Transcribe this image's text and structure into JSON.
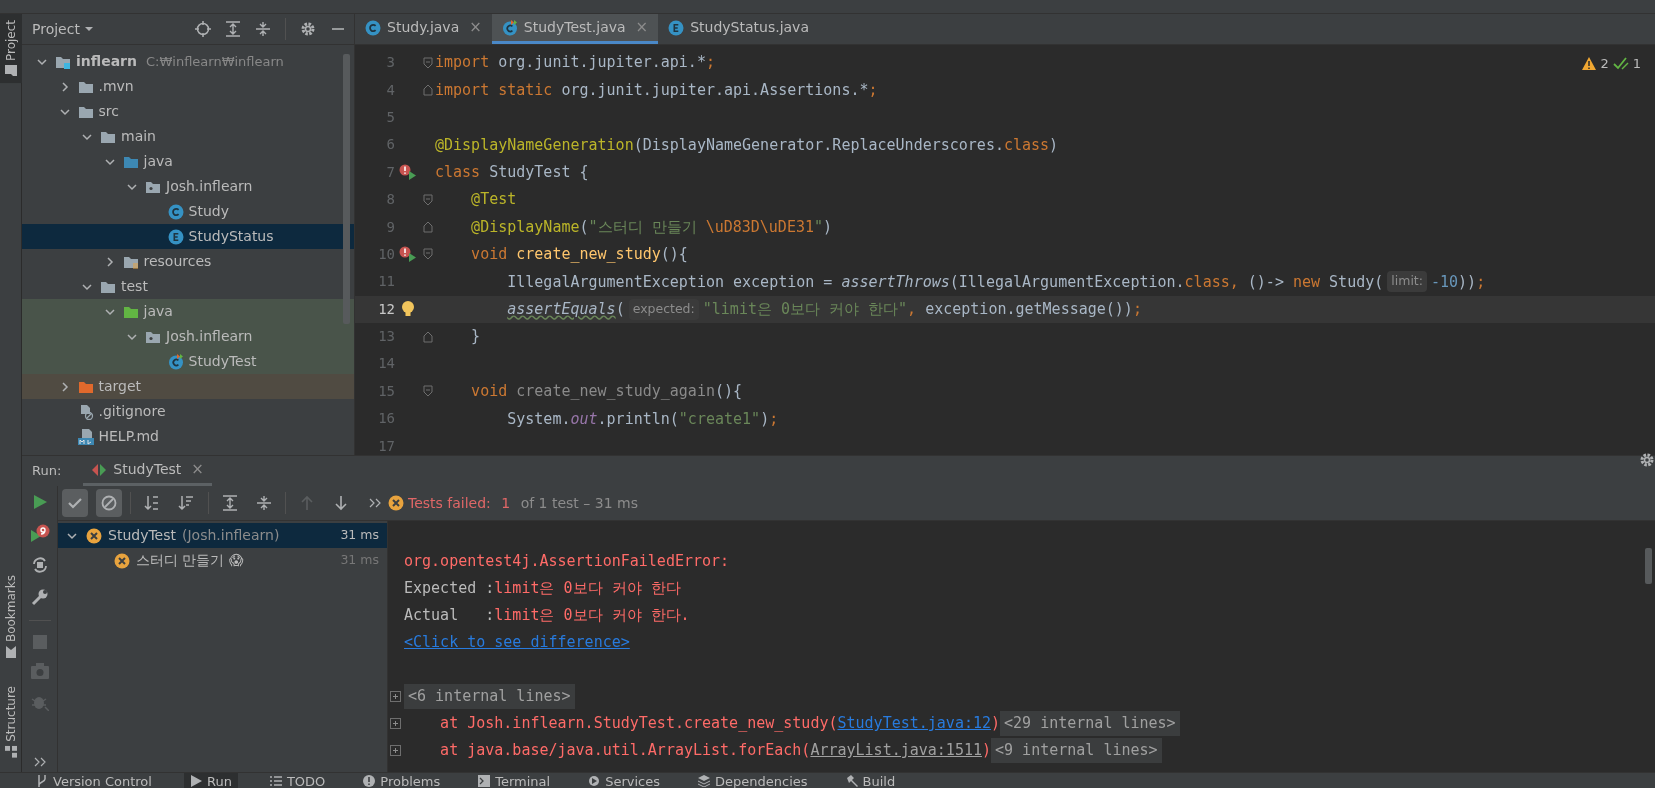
{
  "left_stripe": [
    {
      "label": "Project",
      "selected": true,
      "kind": "project"
    },
    {
      "label": "Bookmarks",
      "selected": false,
      "kind": "bookmarks"
    },
    {
      "label": "Structure",
      "selected": false,
      "kind": "structure"
    }
  ],
  "project": {
    "title": "Project",
    "tree": [
      {
        "name": "inflearn",
        "path": "C:₩inflearn₩inflearn",
        "kind": "module",
        "expanded": true,
        "selected": false,
        "children": [
          {
            "name": ".mvn",
            "kind": "folder",
            "expanded": false,
            "selected": false
          },
          {
            "name": "src",
            "kind": "folder",
            "expanded": true,
            "selected": false,
            "children": [
              {
                "name": "main",
                "kind": "folder",
                "expanded": true,
                "selected": false,
                "children": [
                  {
                    "name": "java",
                    "kind": "source-root",
                    "expanded": true,
                    "selected": false,
                    "children": [
                      {
                        "name": "Josh.inflearn",
                        "kind": "package",
                        "expanded": true,
                        "selected": false,
                        "children": [
                          {
                            "name": "Study",
                            "kind": "class",
                            "selected": false
                          },
                          {
                            "name": "StudyStatus",
                            "kind": "enum",
                            "selected": true
                          }
                        ]
                      }
                    ]
                  },
                  {
                    "name": "resources",
                    "kind": "resources-root",
                    "expanded": false,
                    "selected": false
                  }
                ]
              },
              {
                "name": "test",
                "kind": "folder",
                "expanded": true,
                "selected": false,
                "children": [
                  {
                    "name": "java",
                    "kind": "test-root",
                    "expanded": true,
                    "selected": false,
                    "children": [
                      {
                        "name": "Josh.inflearn",
                        "kind": "package",
                        "expanded": true,
                        "selected": false,
                        "children": [
                          {
                            "name": "StudyTest",
                            "kind": "test-class",
                            "selected": false
                          }
                        ]
                      }
                    ]
                  }
                ]
              }
            ]
          },
          {
            "name": "target",
            "kind": "excluded-folder",
            "expanded": false,
            "selected": false
          },
          {
            "name": ".gitignore",
            "kind": "ignore-file",
            "selected": false
          },
          {
            "name": "HELP.md",
            "kind": "markdown-file",
            "selected": false
          }
        ]
      }
    ]
  },
  "editor": {
    "tabs": [
      {
        "label": "Study.java",
        "kind": "class",
        "selected": false,
        "close": "×"
      },
      {
        "label": "StudyTest.java",
        "kind": "test-class",
        "selected": true,
        "close": "×"
      },
      {
        "label": "StudyStatus.java",
        "kind": "enum",
        "selected": false
      }
    ],
    "warnings": "2",
    "passed": "1",
    "lines": [
      {
        "number": "3",
        "current": false,
        "markers": [
          {
            "kind": "fold-start"
          }
        ],
        "tokens": [
          {
            "text": "import ",
            "kind": "keyword"
          },
          {
            "text": "org.junit.jupiter.api.*",
            "kind": "plain"
          },
          {
            "text": ";",
            "kind": "keyword"
          }
        ]
      },
      {
        "number": "4",
        "current": false,
        "markers": [
          {
            "kind": "fold-end"
          }
        ],
        "tokens": [
          {
            "text": "import static ",
            "kind": "keyword"
          },
          {
            "text": "org.junit.jupiter.api.Assertions.*",
            "kind": "plain"
          },
          {
            "text": ";",
            "kind": "keyword"
          }
        ]
      },
      {
        "number": "5",
        "current": false
      },
      {
        "number": "6",
        "current": false,
        "tokens": [
          {
            "text": "@DisplayNameGeneration",
            "kind": "annotation"
          },
          {
            "text": "(DisplayNameGenerator.ReplaceUnderscores.",
            "kind": "plain"
          },
          {
            "text": "class",
            "kind": "keyword"
          },
          {
            "text": ")",
            "kind": "plain"
          }
        ]
      },
      {
        "number": "7",
        "current": false,
        "markers": [
          {
            "kind": "run-failed"
          }
        ],
        "tokens": [
          {
            "text": "class ",
            "kind": "keyword"
          },
          {
            "text": "StudyTest {",
            "kind": "plain"
          }
        ]
      },
      {
        "number": "8",
        "current": false,
        "markers": [
          {
            "kind": "fold-start"
          }
        ],
        "tokens": [
          {
            "text": "    @Test",
            "kind": "annotation"
          }
        ]
      },
      {
        "number": "9",
        "current": false,
        "markers": [
          {
            "kind": "fold-end"
          }
        ],
        "tokens": [
          {
            "text": "    @DisplayName",
            "kind": "annotation"
          },
          {
            "text": "(",
            "kind": "plain"
          },
          {
            "text": "\"스터디 만들기 ",
            "kind": "string"
          },
          {
            "text": "\\uD83D\\uDE31",
            "kind": "escape"
          },
          {
            "text": "\"",
            "kind": "string"
          },
          {
            "text": ")",
            "kind": "plain"
          }
        ]
      },
      {
        "number": "10",
        "current": false,
        "markers": [
          {
            "kind": "run-failed"
          },
          {
            "kind": "fold-start"
          }
        ],
        "tokens": [
          {
            "text": "    void ",
            "kind": "keyword"
          },
          {
            "text": "create_new_study",
            "kind": "method"
          },
          {
            "text": "(){",
            "kind": "plain"
          }
        ]
      },
      {
        "number": "11",
        "current": false,
        "tokens": [
          {
            "text": "        IllegalArgumentException exception = ",
            "kind": "plain"
          },
          {
            "text": "assertThrows",
            "kind": "static"
          },
          {
            "text": "(IllegalArgumentException.",
            "kind": "plain"
          },
          {
            "text": "class,",
            "kind": "keyword"
          },
          {
            "text": " ()-> ",
            "kind": "plain"
          },
          {
            "text": "new ",
            "kind": "keyword"
          },
          {
            "text": "Study(",
            "kind": "plain"
          },
          {
            "text": "limit:",
            "kind": "hint"
          },
          {
            "text": "-10",
            "kind": "number"
          },
          {
            "text": "))",
            "kind": "plain"
          },
          {
            "text": ";",
            "kind": "keyword"
          }
        ]
      },
      {
        "number": "12",
        "current": true,
        "markers": [
          {
            "kind": "bulb"
          }
        ],
        "tokens": [
          {
            "text": "        assertEquals",
            "kind": "static-warning"
          },
          {
            "text": "(",
            "kind": "plain"
          },
          {
            "text": "expected:",
            "kind": "hint"
          },
          {
            "text": "\"limit은 0보다 커야 한다\"",
            "kind": "string"
          },
          {
            "text": ",",
            "kind": "keyword"
          },
          {
            "text": " exception.getMessage())",
            "kind": "plain"
          },
          {
            "text": ";",
            "kind": "keyword"
          }
        ]
      },
      {
        "number": "13",
        "current": false,
        "markers": [
          {
            "kind": "fold-end"
          }
        ],
        "tokens": [
          {
            "text": "    }",
            "kind": "plain"
          }
        ]
      },
      {
        "number": "14",
        "current": false
      },
      {
        "number": "15",
        "current": false,
        "markers": [
          {
            "kind": "fold-start"
          }
        ],
        "tokens": [
          {
            "text": "    void ",
            "kind": "keyword"
          },
          {
            "text": "create_new_study_again",
            "kind": "unused"
          },
          {
            "text": "(){",
            "kind": "plain"
          }
        ]
      },
      {
        "number": "16",
        "current": false,
        "tokens": [
          {
            "text": "        System.",
            "kind": "plain"
          },
          {
            "text": "out",
            "kind": "field"
          },
          {
            "text": ".println(",
            "kind": "plain"
          },
          {
            "text": "\"create1\"",
            "kind": "string"
          },
          {
            "text": ")",
            "kind": "plain"
          },
          {
            "text": ";",
            "kind": "keyword"
          }
        ]
      },
      {
        "number": "17",
        "current": false
      }
    ]
  },
  "run": {
    "label": "Run:",
    "tab": {
      "label": "StudyTest",
      "close": "×",
      "selected": true
    },
    "side_tools": [
      {
        "kind": "rerun",
        "disabled": false
      },
      {
        "kind": "rerun-failed",
        "disabled": false
      },
      {
        "kind": "auto-test",
        "disabled": false
      },
      {
        "kind": "settings",
        "disabled": false
      },
      {
        "kind": "stop",
        "disabled": true
      },
      {
        "kind": "snapshot",
        "disabled": true
      },
      {
        "kind": "debug",
        "disabled": true
      },
      {
        "kind": "more",
        "disabled": false
      }
    ],
    "toolbar": [
      {
        "kind": "show-passed",
        "on": true,
        "disabled": false
      },
      {
        "kind": "show-ignored",
        "on": true,
        "disabled": false
      },
      {
        "kind": "sort-alpha",
        "on": false,
        "disabled": false
      },
      {
        "kind": "sort-duration",
        "on": false,
        "disabled": false
      },
      {
        "kind": "expand-all",
        "on": false,
        "disabled": false
      },
      {
        "kind": "collapse-all",
        "on": false,
        "disabled": false
      },
      {
        "kind": "previous",
        "on": false,
        "disabled": true
      },
      {
        "kind": "next",
        "on": false,
        "disabled": false
      },
      {
        "kind": "more",
        "on": false,
        "disabled": false
      }
    ],
    "status": {
      "label": "Tests failed: ",
      "count": "1",
      "detail": " of 1 test – 31 ms"
    },
    "results": [
      {
        "name": "StudyTest",
        "package": "(Josh.inflearn)",
        "time": "31 ms",
        "expanded": true,
        "selected": true,
        "children": [
          {
            "name": "스터디 만들기 😱",
            "time": "31 ms",
            "selected": false
          }
        ]
      }
    ],
    "output": [
      {
        "expander": false
      },
      {
        "expander": false,
        "segments": [
          {
            "text": "org.opentest4j.AssertionFailedError:",
            "kind": "error"
          }
        ]
      },
      {
        "expander": false,
        "segments": [
          {
            "text": "Expected :",
            "kind": "plain"
          },
          {
            "text": "limit은 0보다 커야 한다",
            "kind": "error"
          }
        ]
      },
      {
        "expander": false,
        "segments": [
          {
            "text": "Actual   :",
            "kind": "plain"
          },
          {
            "text": "limit은 0보다 커야 한다.",
            "kind": "error"
          }
        ]
      },
      {
        "expander": false,
        "segments": [
          {
            "text": "<Click to see difference>",
            "kind": "link"
          }
        ]
      },
      {
        "expander": false
      },
      {
        "expander": true,
        "segments": [
          {
            "text": "<6 internal lines>",
            "kind": "folded"
          }
        ]
      },
      {
        "expander": true,
        "segments": [
          {
            "text": "    at Josh.inflearn.StudyTest.create_new_study(",
            "kind": "error"
          },
          {
            "text": "StudyTest.java:12",
            "kind": "link"
          },
          {
            "text": ")",
            "kind": "error"
          },
          {
            "text": "<29 internal lines>",
            "kind": "folded"
          }
        ]
      },
      {
        "expander": true,
        "segments": [
          {
            "text": "    at java.base/java.util.ArrayList.forEach(",
            "kind": "error"
          },
          {
            "text": "ArrayList.java:1511",
            "kind": "muted-link"
          },
          {
            "text": ")",
            "kind": "error"
          },
          {
            "text": "<9 internal lines>",
            "kind": "folded"
          }
        ]
      }
    ]
  },
  "bottom_tabs": [
    {
      "label": "Version Control",
      "kind": "vcs",
      "selected": false
    },
    {
      "label": "Run",
      "kind": "run",
      "selected": true
    },
    {
      "label": "TODO",
      "kind": "todo",
      "selected": false
    },
    {
      "label": "Problems",
      "kind": "problems",
      "selected": false
    },
    {
      "label": "Terminal",
      "kind": "terminal",
      "selected": false
    },
    {
      "label": "Services",
      "kind": "services",
      "selected": false
    },
    {
      "label": "Dependencies",
      "kind": "dependencies",
      "selected": false
    },
    {
      "label": "Build",
      "kind": "build",
      "selected": false
    }
  ]
}
